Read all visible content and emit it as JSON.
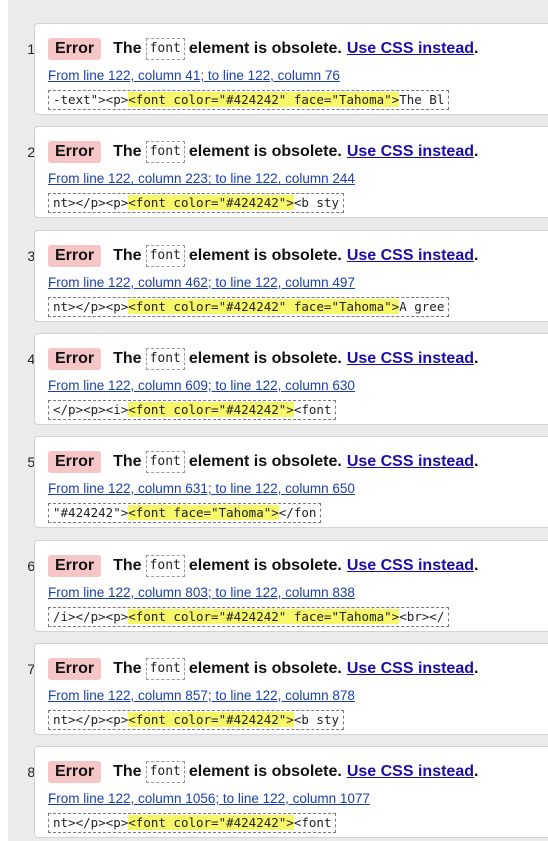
{
  "errors": [
    {
      "num": "1.",
      "badge": "Error",
      "the": "The",
      "element": "font",
      "message": "element is obsolete.",
      "link": "Use CSS instead",
      "period": ".",
      "location": "From line 122, column 41; to line 122, column 76",
      "snippet_before": "-text\"><p>",
      "snippet_highlight": "<font color=\"#424242\" face=\"Tahoma\">",
      "snippet_after": "The Bl"
    },
    {
      "num": "2.",
      "badge": "Error",
      "the": "The",
      "element": "font",
      "message": "element is obsolete.",
      "link": "Use CSS instead",
      "period": ".",
      "location": "From line 122, column 223; to line 122, column 244",
      "snippet_before": "nt></p><p>",
      "snippet_highlight": "<font color=\"#424242\">",
      "snippet_after": "<b sty"
    },
    {
      "num": "3.",
      "badge": "Error",
      "the": "The",
      "element": "font",
      "message": "element is obsolete.",
      "link": "Use CSS instead",
      "period": ".",
      "location": "From line 122, column 462; to line 122, column 497",
      "snippet_before": "nt></p><p>",
      "snippet_highlight": "<font color=\"#424242\" face=\"Tahoma\">",
      "snippet_after": "A gree"
    },
    {
      "num": "4.",
      "badge": "Error",
      "the": "The",
      "element": "font",
      "message": "element is obsolete.",
      "link": "Use CSS instead",
      "period": ".",
      "location": "From line 122, column 609; to line 122, column 630",
      "snippet_before": "</p><p><i>",
      "snippet_highlight": "<font color=\"#424242\">",
      "snippet_after": "<font "
    },
    {
      "num": "5.",
      "badge": "Error",
      "the": "The",
      "element": "font",
      "message": "element is obsolete.",
      "link": "Use CSS instead",
      "period": ".",
      "location": "From line 122, column 631; to line 122, column 650",
      "snippet_before": "\"#424242\">",
      "snippet_highlight": "<font face=\"Tahoma\">",
      "snippet_after": "</fon"
    },
    {
      "num": "6.",
      "badge": "Error",
      "the": "The",
      "element": "font",
      "message": "element is obsolete.",
      "link": "Use CSS instead",
      "period": ".",
      "location": "From line 122, column 803; to line 122, column 838",
      "snippet_before": "/i></p><p>",
      "snippet_highlight": "<font color=\"#424242\" face=\"Tahoma\">",
      "snippet_after": "<br></"
    },
    {
      "num": "7.",
      "badge": "Error",
      "the": "The",
      "element": "font",
      "message": "element is obsolete.",
      "link": "Use CSS instead",
      "period": ".",
      "location": "From line 122, column 857; to line 122, column 878",
      "snippet_before": "nt></p><p>",
      "snippet_highlight": "<font color=\"#424242\">",
      "snippet_after": "<b sty"
    },
    {
      "num": "8.",
      "badge": "Error",
      "the": "The",
      "element": "font",
      "message": "element is obsolete.",
      "link": "Use CSS instead",
      "period": ".",
      "location": "From line 122, column 1056; to line 122, column 1077",
      "snippet_before": "nt></p><p>",
      "snippet_highlight": "<font color=\"#424242\">",
      "snippet_after": "<font "
    }
  ],
  "colors": {
    "badge_bg": "#f6c6c6",
    "link": "#1a0dab",
    "highlight": "#f7f76a",
    "panel_bg": "#ebebeb"
  }
}
